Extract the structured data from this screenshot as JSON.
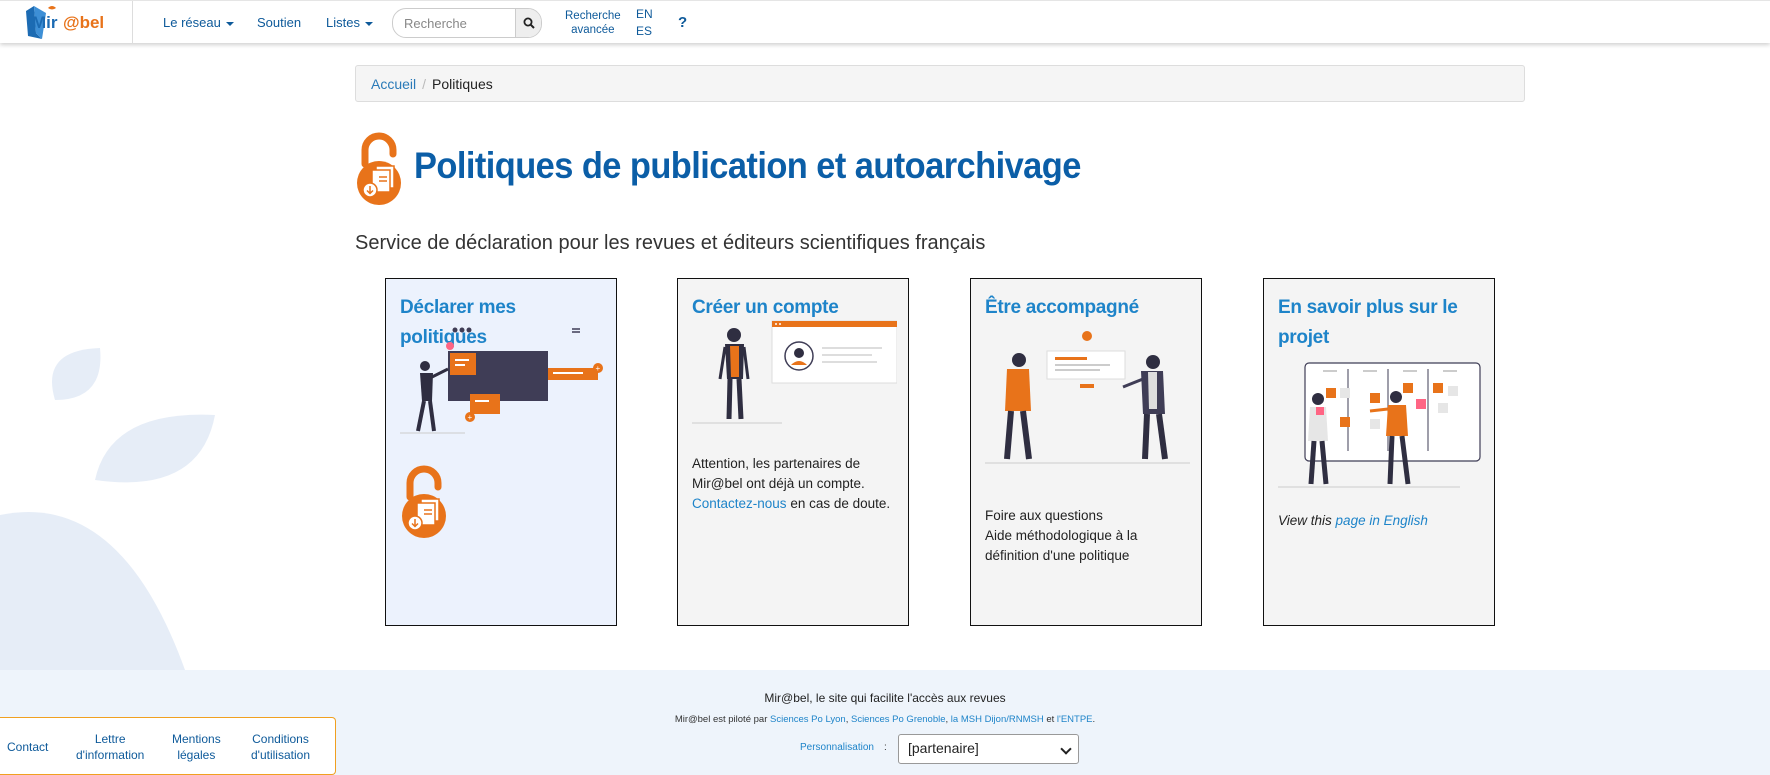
{
  "navbar": {
    "logo_text_a": "Mir",
    "logo_text_b": "@bel",
    "items": [
      {
        "label": "Le réseau",
        "dropdown": true
      },
      {
        "label": "Soutien",
        "dropdown": false
      },
      {
        "label": "Listes",
        "dropdown": true
      }
    ],
    "search": {
      "placeholder": "Recherche"
    },
    "advanced_search": {
      "line1": "Recherche",
      "line2": "avancée"
    },
    "languages": [
      "EN",
      "ES"
    ],
    "help": "?"
  },
  "breadcrumb": {
    "home": "Accueil",
    "current": "Politiques"
  },
  "page": {
    "title": "Politiques de publication et autoarchivage",
    "subtitle": "Service de déclaration pour les revues et éditeurs scientifiques français"
  },
  "cards": [
    {
      "title": "Déclarer mes politiques"
    },
    {
      "title": "Créer un compte",
      "text_before": "Attention, les partenaires de Mir@bel ont déjà un compte.",
      "link": "Contactez-nous",
      "text_after": "en cas de doute."
    },
    {
      "title": "Être accompagné",
      "line1": "Foire aux questions",
      "line2": "Aide méthodologique à la définition d'une politique"
    },
    {
      "title": "En savoir plus sur le projet",
      "text_before": "View this",
      "link": "page in English"
    }
  ],
  "footer": {
    "tagline": "Mir@bel, le site qui facilite l'accès aux revues",
    "piloted_prefix": "Mir@bel est piloté par",
    "pilots": [
      "Sciences Po Lyon",
      "Sciences Po Grenoble",
      "la MSH Dijon/RNMSH",
      "l'ENTPE"
    ],
    "piloted_and": "et",
    "personalisation_label": "Personnalisation",
    "personalisation_colon": ":",
    "personalisation_value": "[partenaire]",
    "links": [
      {
        "line1": "Contact",
        "line2": ""
      },
      {
        "line1": "Lettre",
        "line2": "d'information"
      },
      {
        "line1": "Mentions",
        "line2": "légales"
      },
      {
        "line1": "Conditions",
        "line2": "d'utilisation"
      }
    ]
  },
  "colors": {
    "brand_blue": "#0b5ea7",
    "link_blue": "#1e84c9",
    "orange": "#e8731a",
    "dark": "#2f2e41"
  }
}
